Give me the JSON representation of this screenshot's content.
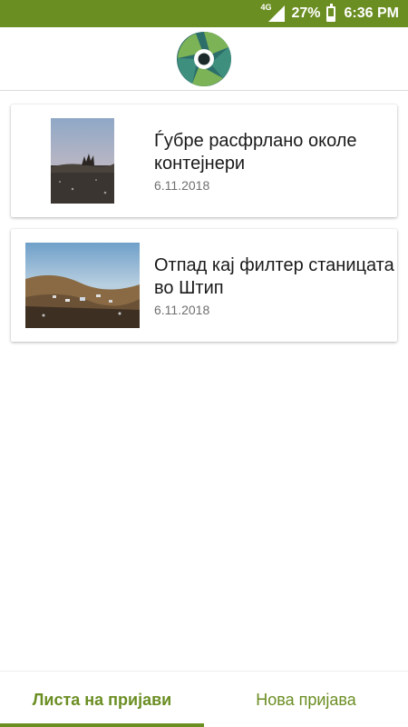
{
  "status_bar": {
    "network": "4G",
    "battery_percent": "27%",
    "battery_level": 0.27,
    "time": "6:36 PM",
    "icons": [
      "signal-icon",
      "battery-icon"
    ]
  },
  "header": {
    "logo_icon": "camera-aperture-logo"
  },
  "reports": [
    {
      "title": "Ѓубре расфрлано околе контејнери",
      "date": "6.11.2018",
      "image": "photo of scattered waste at dusk"
    },
    {
      "title": "Отпад кај филтер станицата во Штип",
      "date": "6.11.2018",
      "image": "photo of waste on a hillside"
    }
  ],
  "bottom_nav": {
    "tabs": [
      {
        "label": "Листа на пријави",
        "active": true
      },
      {
        "label": "Нова пријава",
        "active": false
      }
    ]
  },
  "colors": {
    "accent": "#6b8e23",
    "logo_dark": "#2c6e6a",
    "logo_light": "#7cb356"
  }
}
